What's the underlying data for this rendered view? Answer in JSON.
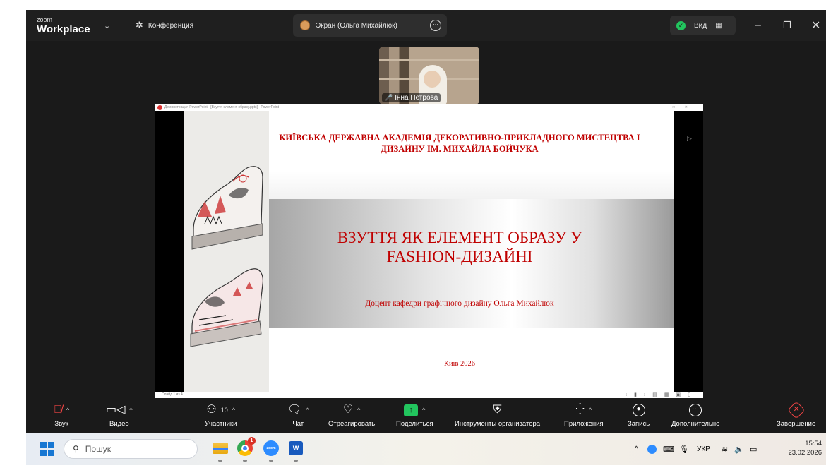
{
  "zoom": {
    "brand_small": "zoom",
    "brand_big": "Workplace",
    "conference_label": "Конференция",
    "screen_tab_label": "Экран (Ольга Михайлюк)",
    "view_label": "Вид",
    "participant_name": "Інна Петрова"
  },
  "powerpoint": {
    "title_bar": "Демонстрация PowerPoint - [Взуття елемент образу.pptx] - PowerPoint",
    "status_bar": "Слайд 1 из 4"
  },
  "slide": {
    "academy": "КИЇВСЬКА ДЕРЖАВНА АКАДЕМІЯ ДЕКОРАТИВНО-ПРИКЛАДНОГО МИСТЕЦТВА І ДИЗАЙНУ ІМ. МИХАЙЛА БОЙЧУКА",
    "title_line1": "ВЗУТТЯ ЯК ЕЛЕМЕНТ ОБРАЗУ У",
    "title_line2": "FASHION-ДИЗАЙНІ",
    "author": "Доцент кафедри графічного дизайну Ольга Михайлюк",
    "city_year": "Київ 2026"
  },
  "toolbar": {
    "audio": "Звук",
    "video": "Видео",
    "participants": "Участники",
    "participants_count": "10",
    "chat": "Чат",
    "react": "Отреагировать",
    "share": "Поделиться",
    "host_tools": "Инструменты организатора",
    "apps": "Приложения",
    "record": "Запись",
    "more": "Дополнительно",
    "end": "Завершение"
  },
  "taskbar": {
    "search_placeholder": "Пошук",
    "chrome_badge": "1",
    "zoom_app_label": "zoom",
    "word_app_label": "W",
    "language": "УКР",
    "time": "15:54",
    "date": "23.02.2026"
  },
  "colors": {
    "slide_red": "#c00000",
    "share_green": "#22c55e",
    "end_red": "#ef4444"
  }
}
